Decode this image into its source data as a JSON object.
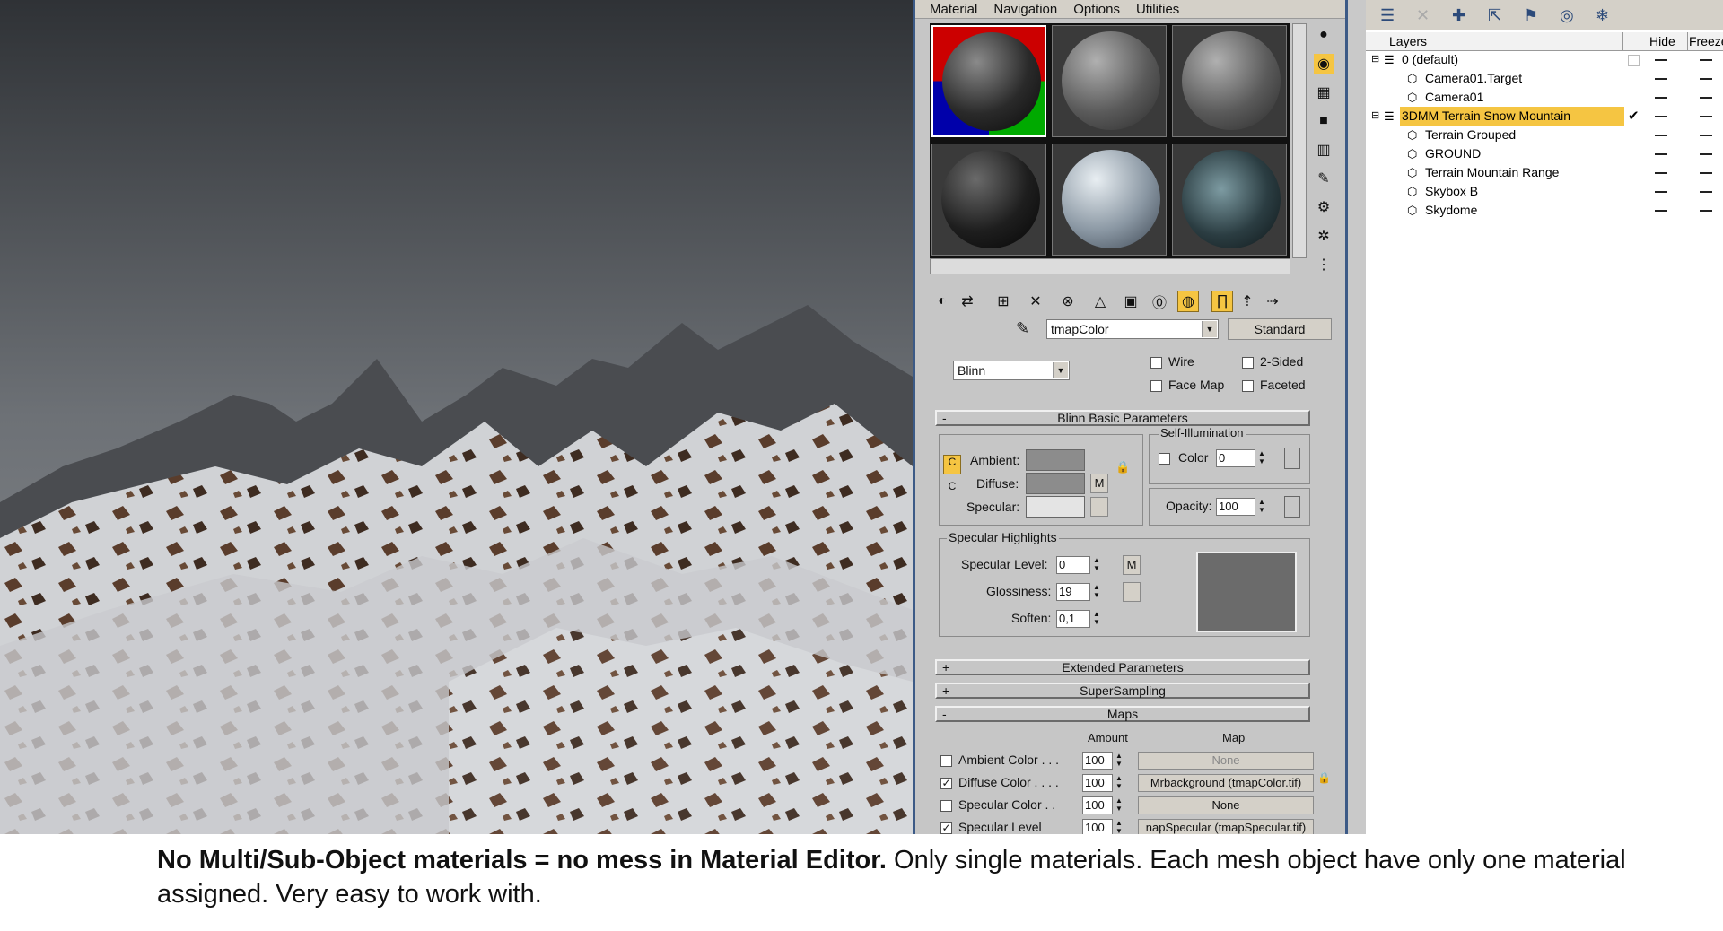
{
  "material_editor": {
    "menu": [
      "Material",
      "Navigation",
      "Options",
      "Utilities"
    ],
    "material_name": "tmapColor",
    "material_type": "Standard",
    "shader": "Blinn",
    "checks": {
      "wire": "Wire",
      "two_sided": "2-Sided",
      "face_map": "Face Map",
      "faceted": "Faceted"
    },
    "blinn_title": "Blinn Basic Parameters",
    "ambient": "Ambient:",
    "diffuse": "Diffuse:",
    "specular": "Specular:",
    "m": "M",
    "self_illum_title": "Self-Illumination",
    "color": "Color",
    "self_illum_value": "0",
    "opacity_label": "Opacity:",
    "opacity_value": "100",
    "spec_highlights_title": "Specular Highlights",
    "spec_level_label": "Specular Level:",
    "spec_level_value": "0",
    "glossiness_label": "Glossiness:",
    "glossiness_value": "19",
    "soften_label": "Soften:",
    "soften_value": "0,1",
    "extended": "Extended Parameters",
    "supersampling": "SuperSampling",
    "maps_title": "Maps",
    "plus": "+",
    "minus": "-",
    "amount_header": "Amount",
    "map_header": "Map",
    "maps": [
      {
        "name": "Ambient Color . . .",
        "amount": "100",
        "map": "None",
        "checked": false
      },
      {
        "name": "Diffuse Color . . . .",
        "amount": "100",
        "map": "Mrbackground (tmapColor.tif)",
        "checked": true
      },
      {
        "name": "Specular Color . .",
        "amount": "100",
        "map": "None",
        "checked": false
      },
      {
        "name": "Specular Level",
        "amount": "100",
        "map": "napSpecular (tmapSpecular.tif)",
        "checked": true
      }
    ]
  },
  "layers": {
    "header": "Layers",
    "hide": "Hide",
    "freeze": "Freeze",
    "rows": [
      {
        "name": "0 (default)",
        "type": "layer"
      },
      {
        "name": "Camera01.Target",
        "type": "object"
      },
      {
        "name": "Camera01",
        "type": "object"
      },
      {
        "name": "3DMM Terrain Snow Mountain",
        "type": "layer",
        "active": true
      },
      {
        "name": "Terrain Grouped",
        "type": "object"
      },
      {
        "name": "GROUND",
        "type": "object"
      },
      {
        "name": "Terrain Mountain Range",
        "type": "object"
      },
      {
        "name": "Skybox B",
        "type": "object"
      },
      {
        "name": "Skydome",
        "type": "object"
      }
    ]
  },
  "caption": {
    "bold": "No Multi/Sub-Object materials = no mess in Material Editor.",
    "normal": " Only single materials. Each mesh object have only one material assigned. Very easy to work with."
  },
  "colors": {
    "highlight": "#f5c542",
    "frame": "#3c5a86"
  }
}
